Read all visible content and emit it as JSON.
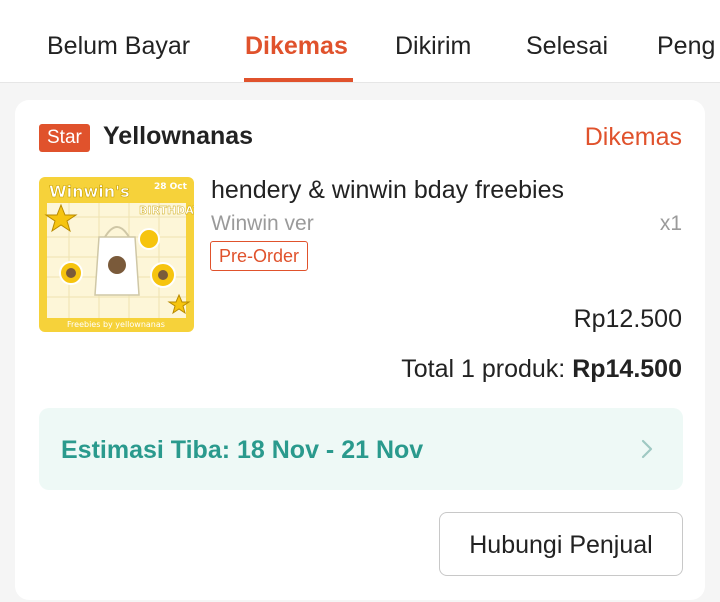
{
  "tabs": [
    {
      "label": "Belum Bayar",
      "active": false
    },
    {
      "label": "Dikemas",
      "active": true
    },
    {
      "label": "Dikirim",
      "active": false
    },
    {
      "label": "Selesai",
      "active": false
    },
    {
      "label": "Peng",
      "active": false
    }
  ],
  "order": {
    "shop_badge": "Star",
    "shop_name": "Yellownanas",
    "status": "Dikemas",
    "product": {
      "title": "hendery & winwin bday freebies",
      "variant": "Winwin ver",
      "quantity": "x1",
      "tag": "Pre-Order",
      "price": "Rp12.500",
      "image_text": {
        "headline": "Winwin's",
        "subheadline": "BIRTHDAY",
        "date": "28 Oct",
        "footer": "Freebies by yellownanas"
      }
    },
    "total_label": "Total 1 produk:",
    "total_amount": "Rp14.500",
    "eta": {
      "text": "Estimasi Tiba: 18 Nov - 21 Nov",
      "icon": "chevron-right-icon"
    },
    "contact_button": "Hubungi Penjual"
  },
  "colors": {
    "accent": "#e0522c",
    "eta_text": "#2a9a8d",
    "eta_bg": "#eef9f6",
    "thumb_bg": "#f6d23a"
  }
}
